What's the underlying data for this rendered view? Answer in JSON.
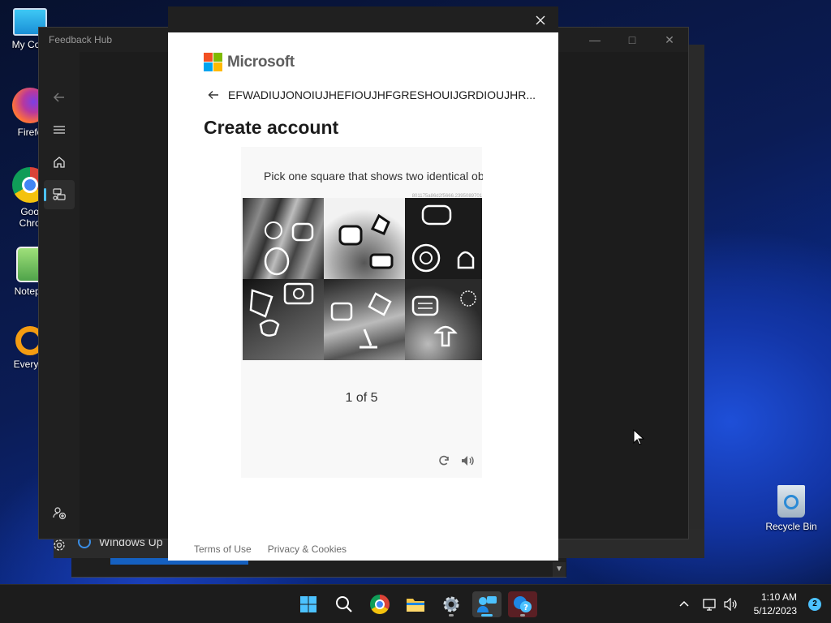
{
  "desktop": {
    "icons": [
      {
        "label": "My Com",
        "icon": "monitor-icon"
      },
      {
        "label": "Firefo",
        "icon": "firefox-icon"
      },
      {
        "label": "Goog Chron",
        "icon": "chrome-icon"
      },
      {
        "label": "Notepa",
        "icon": "notepad-icon"
      },
      {
        "label": "Everyth",
        "icon": "everything-search-icon"
      }
    ],
    "recycle_bin": "Recycle Bin"
  },
  "feedback_hub": {
    "title": "Feedback Hub",
    "nav": [
      "back-icon",
      "menu-icon",
      "home-icon",
      "feedback-icon",
      "add-person-icon",
      "settings-icon"
    ]
  },
  "background": {
    "windows_update_label": "Windows Up"
  },
  "dialog": {
    "brand": "Microsoft",
    "brand_colors": [
      "#f25022",
      "#7fba00",
      "#00a4ef",
      "#ffb900"
    ],
    "account_name": "EFWADIUJONOIUJHEFIOUJHFGRESHOUIJGRDIOUJHR...",
    "heading": "Create account",
    "captcha": {
      "prompt": "Pick one square that shows two identical objects.",
      "id_text": "801175a86d2f5666.2395089701",
      "page_text": "1 of 5",
      "tool_icons": [
        "refresh-icon",
        "audio-icon"
      ]
    },
    "footer": {
      "terms": "Terms of Use",
      "privacy": "Privacy & Cookies"
    }
  },
  "taskbar": {
    "apps": [
      "start-icon",
      "search-icon",
      "chrome-icon",
      "file-explorer-icon",
      "settings-icon",
      "feedback-hub-icon",
      "get-help-icon"
    ],
    "time": "1:10 AM",
    "date": "5/12/2023",
    "notification_count": "2"
  }
}
